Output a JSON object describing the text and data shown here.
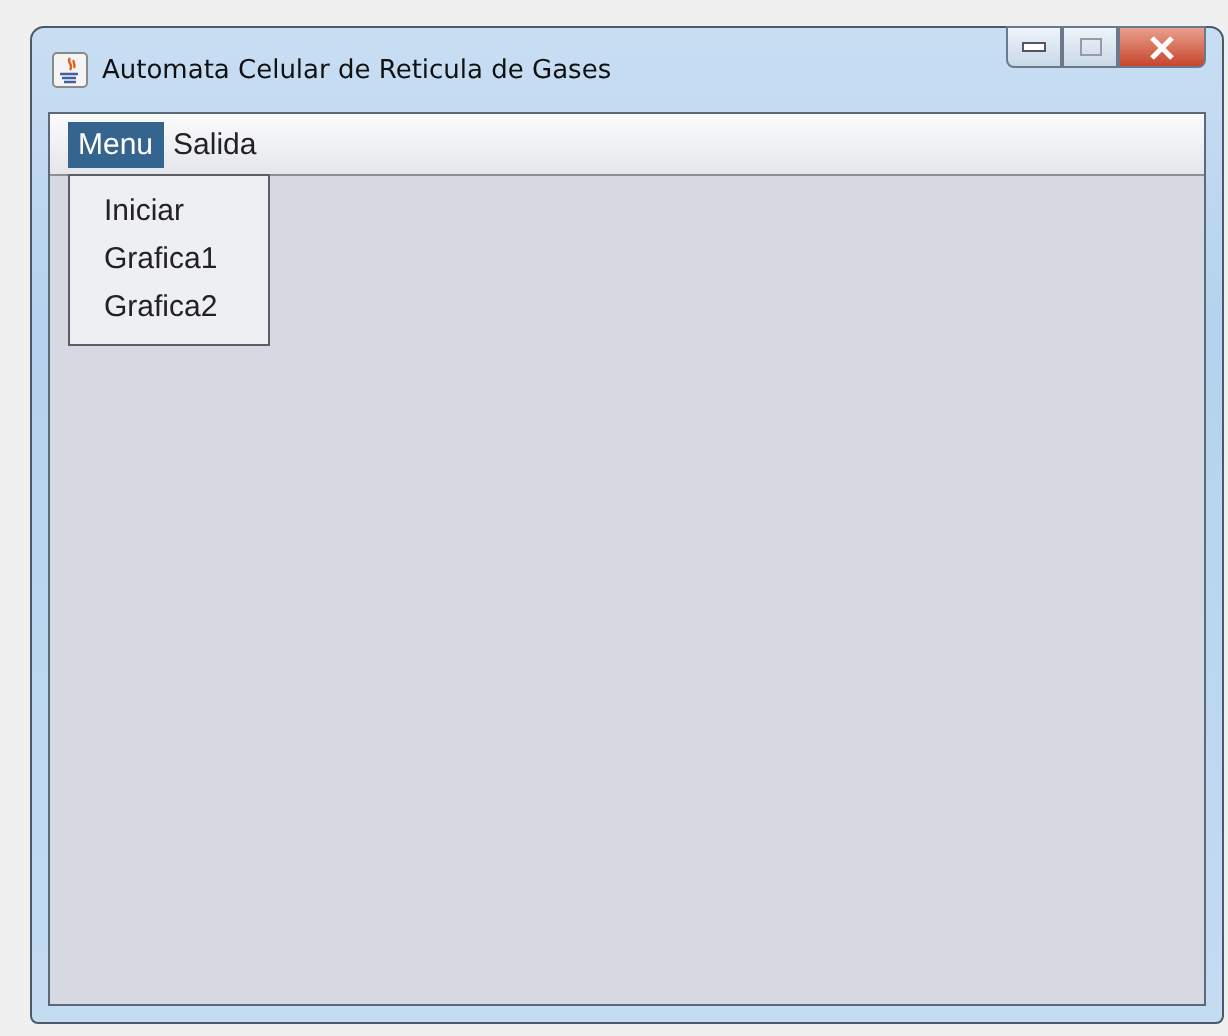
{
  "window": {
    "title": "Automata Celular de Reticula de Gases"
  },
  "menu_bar": [
    {
      "label": "Menu",
      "selected": true
    },
    {
      "label": "Salida",
      "selected": false
    }
  ],
  "dropdown": {
    "items": [
      {
        "label": "Iniciar"
      },
      {
        "label": "Grafica1"
      },
      {
        "label": "Grafica2"
      }
    ]
  }
}
